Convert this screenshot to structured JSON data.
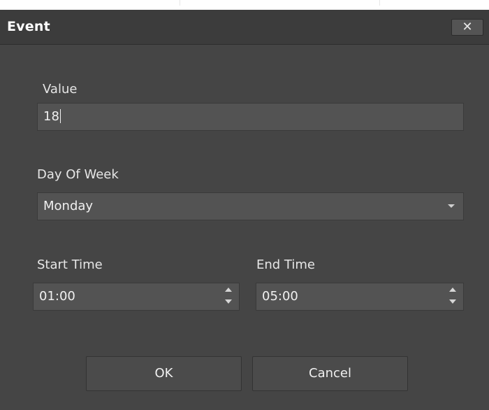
{
  "dialog": {
    "title": "Event",
    "close_glyph": "✕"
  },
  "form": {
    "value_label": "Value",
    "value_input": "18",
    "day_label": "Day Of Week",
    "day_value": "Monday",
    "start_label": "Start Time",
    "start_value": "01:00",
    "end_label": "End Time",
    "end_value": "05:00"
  },
  "buttons": {
    "ok": "OK",
    "cancel": "Cancel"
  },
  "icons": {
    "close": "close-icon",
    "dropdown": "chevron-down-icon",
    "spin_up": "spin-up-icon",
    "spin_down": "spin-down-icon"
  },
  "colors": {
    "dialog_bg": "#454545",
    "titlebar_bg": "#3c3c3c",
    "field_bg": "#535353",
    "text": "#f0f0f0"
  }
}
